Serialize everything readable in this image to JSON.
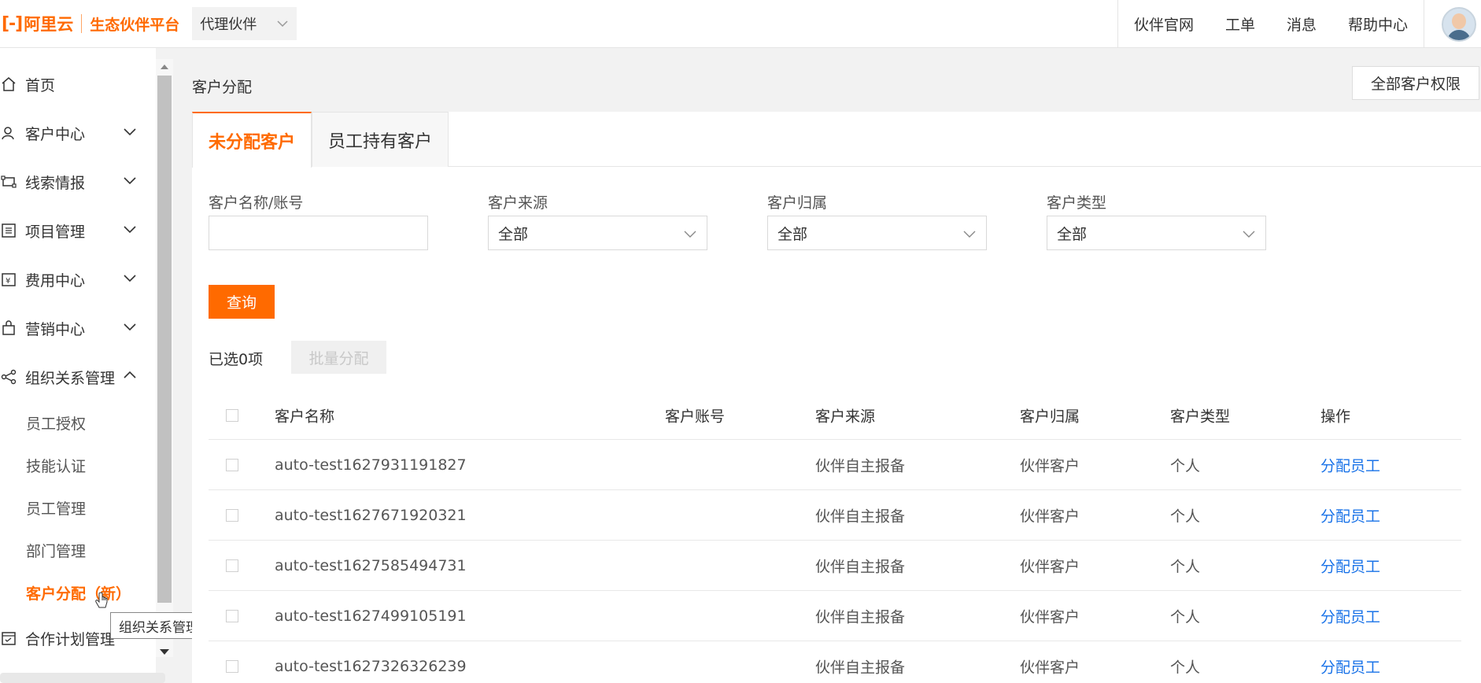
{
  "topbar": {
    "logo_mark": "[-]",
    "logo_name": "阿里云",
    "logo_sub": "生态伙伴平台",
    "role": "代理伙伴",
    "links": [
      "伙伴官网",
      "工单",
      "消息",
      "帮助中心"
    ]
  },
  "sidebar": {
    "items": [
      {
        "label": "首页",
        "icon": "home-icon"
      },
      {
        "label": "客户中心",
        "icon": "customer-icon"
      },
      {
        "label": "线索情报",
        "icon": "leads-icon"
      },
      {
        "label": "项目管理",
        "icon": "project-icon"
      },
      {
        "label": "费用中心",
        "icon": "fee-icon"
      },
      {
        "label": "营销中心",
        "icon": "marketing-icon"
      },
      {
        "label": "组织关系管理",
        "icon": "org-icon"
      },
      {
        "label": "合作计划管理",
        "icon": "plan-icon"
      }
    ],
    "sub_items": [
      "员工授权",
      "技能认证",
      "员工管理",
      "部门管理",
      "客户分配（新）"
    ],
    "tooltip": "组织关系管理"
  },
  "main": {
    "title": "客户分配",
    "all_perm_button": "全部客户权限",
    "tabs": [
      "未分配客户",
      "员工持有客户"
    ],
    "filters": {
      "name_label": "客户名称/账号",
      "source_label": "客户来源",
      "source_value": "全部",
      "belong_label": "客户归属",
      "belong_value": "全部",
      "type_label": "客户类型",
      "type_value": "全部"
    },
    "query_button": "查询",
    "selected_count": "已选0项",
    "batch_button": "批量分配"
  },
  "table": {
    "headers": [
      "客户名称",
      "客户账号",
      "客户来源",
      "客户归属",
      "客户类型",
      "操作"
    ],
    "rows": [
      {
        "name": "auto-test1627931191827",
        "account": "",
        "source": "伙伴自主报备",
        "belong": "伙伴客户",
        "type": "个人",
        "op": "分配员工"
      },
      {
        "name": "auto-test1627671920321",
        "account": "",
        "source": "伙伴自主报备",
        "belong": "伙伴客户",
        "type": "个人",
        "op": "分配员工"
      },
      {
        "name": "auto-test1627585494731",
        "account": "",
        "source": "伙伴自主报备",
        "belong": "伙伴客户",
        "type": "个人",
        "op": "分配员工"
      },
      {
        "name": "auto-test1627499105191",
        "account": "",
        "source": "伙伴自主报备",
        "belong": "伙伴客户",
        "type": "个人",
        "op": "分配员工"
      },
      {
        "name": "auto-test1627326326239",
        "account": "",
        "source": "伙伴自主报备",
        "belong": "伙伴客户",
        "type": "个人",
        "op": "分配员工"
      }
    ]
  },
  "colors": {
    "accent": "#ff6a00",
    "link": "#1a73e8"
  }
}
